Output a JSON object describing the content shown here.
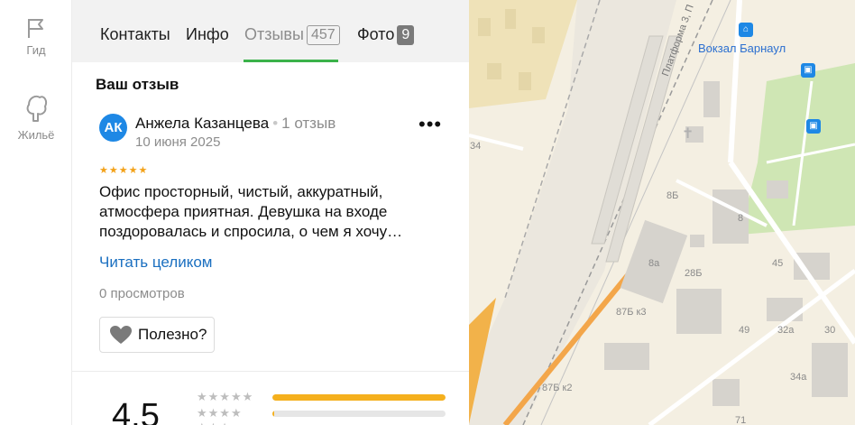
{
  "rail": {
    "guide_label": "Гид",
    "housing_label": "Жильё"
  },
  "tabs": {
    "contacts": "Контакты",
    "info": "Инфо",
    "reviews": "Отзывы",
    "reviews_count": "457",
    "photos": "Фото",
    "photos_count": "9"
  },
  "review": {
    "section_title": "Ваш отзыв",
    "avatar_initials": "АК",
    "author": "Анжела Казанцева",
    "author_reviews": "1 отзыв",
    "date": "10 июня 2025",
    "stars": "★★★★★",
    "rating": 5,
    "text": "Офис просторный, чистый, аккуратный, атмосфера приятная. Девушка на входе поздоровалась и спросила, о чем я хочу…",
    "read_more": "Читать целиком",
    "views": "0 просмотров",
    "useful_label": "Полезно?"
  },
  "summary": {
    "average": "4.5",
    "rows": [
      {
        "stars": "★★★★★",
        "fraction": 1.0
      },
      {
        "stars": "★★★★",
        "fraction": 0.01
      },
      {
        "stars": "★★★",
        "fraction": 0.0
      }
    ]
  },
  "map": {
    "station": "Вокзал Барнаул",
    "platform": "Платформа 3, П",
    "labels": [
      "34",
      "8Б",
      "8",
      "28Б",
      "8а",
      "45",
      "87Б к3",
      "49",
      "32а",
      "30",
      "87Б к2",
      "34а",
      "71"
    ]
  },
  "colors": {
    "accent_green": "#3bb24a",
    "link_blue": "#1a6fc0",
    "star_yellow": "#f3a21a",
    "bar_fill": "#f5b01d"
  }
}
